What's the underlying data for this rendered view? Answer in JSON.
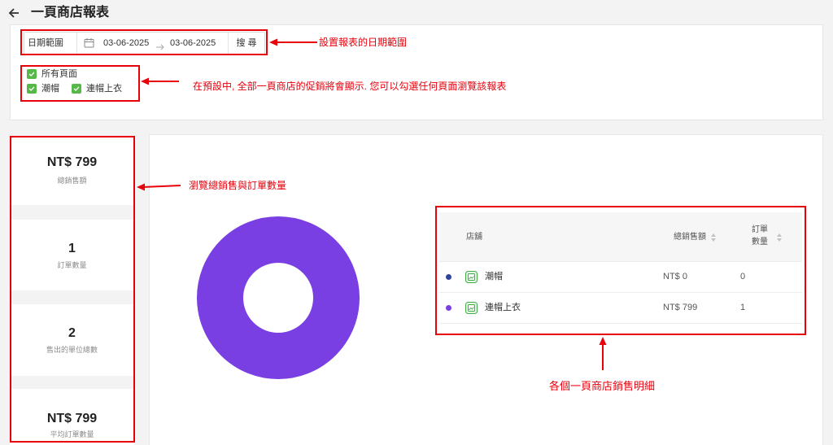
{
  "header": {
    "title": "一頁商店報表",
    "back_icon": "arrow-left-icon"
  },
  "filters": {
    "date_label": "日期範圍",
    "calendar_icon": "calendar-icon",
    "start_date": "03-06-2025",
    "range_icon": "arrow-right-icon",
    "end_date": "03-06-2025",
    "search_label": "搜 尋",
    "checkbox_color": "#55b848",
    "checkboxes": [
      {
        "label": "所有頁面",
        "checked": true
      },
      {
        "label": "潮帽",
        "checked": true
      },
      {
        "label": "連帽上衣",
        "checked": true
      }
    ]
  },
  "stats": [
    {
      "value": "NT$ 799",
      "label": "總銷售額"
    },
    {
      "value": "1",
      "label": "訂單數量"
    },
    {
      "value": "2",
      "label": "售出的單位總數"
    },
    {
      "value": "NT$ 799",
      "label": "平均訂單數量"
    }
  ],
  "table": {
    "headers": {
      "store": "店舖",
      "sales": "總銷售額",
      "orders_line1": "訂單",
      "orders_line2": "數量"
    },
    "sort_icon": "sort-icon",
    "store_icon": "store-page-icon",
    "rows": [
      {
        "color": "#2f4596",
        "store": "潮帽",
        "sales": "NT$ 0",
        "sales_value": 0,
        "orders": "0"
      },
      {
        "color": "#7a3fe2",
        "store": "連帽上衣",
        "sales": "NT$ 799",
        "sales_value": 799,
        "orders": "1"
      }
    ]
  },
  "annotations": {
    "color": "#e8000b",
    "date_range_note": "設置報表的日期範圍",
    "pages_note": "在預設中, 全部一頁商店的促銷將會顯示. 您可以勾選任何頁面瀏覽該報表",
    "stats_note": "瀏覽總銷售與訂單數量",
    "table_note": "各個一頁商店銷售明細"
  }
}
